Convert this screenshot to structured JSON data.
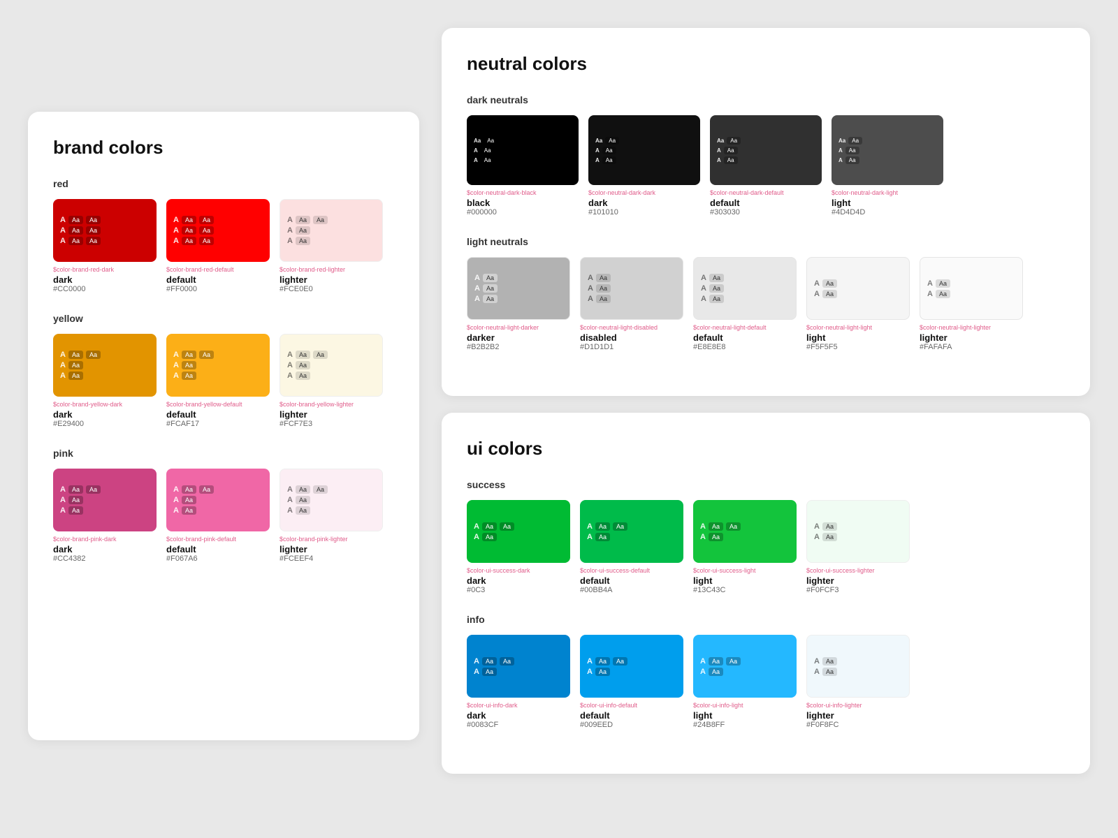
{
  "brand": {
    "title": "brand colors",
    "sections": [
      {
        "name": "red",
        "cards": [
          {
            "token": "$color-brand-red-dark",
            "name": "dark",
            "hex": "#CC0000",
            "bg": "#CC0000",
            "textStyle": "light"
          },
          {
            "token": "$color-brand-red-default",
            "name": "default",
            "hex": "#FF0000",
            "bg": "#FF0000",
            "textStyle": "light"
          },
          {
            "token": "$color-brand-red-lighter",
            "name": "lighter",
            "hex": "#FCE0E0",
            "bg": "#FCE0E0",
            "textStyle": "dark"
          }
        ]
      },
      {
        "name": "yellow",
        "cards": [
          {
            "token": "$color-brand-yellow-dark",
            "name": "dark",
            "hex": "#E29400",
            "bg": "#E29400",
            "textStyle": "light"
          },
          {
            "token": "$color-brand-yellow-default",
            "name": "default",
            "hex": "#FCAF17",
            "bg": "#FCAF17",
            "textStyle": "light"
          },
          {
            "token": "$color-brand-yellow-lighter",
            "name": "lighter",
            "hex": "#FCF7E3",
            "bg": "#FCF7E3",
            "textStyle": "dark"
          }
        ]
      },
      {
        "name": "pink",
        "cards": [
          {
            "token": "$color-brand-pink-dark",
            "name": "dark",
            "hex": "#CC4382",
            "bg": "#CC4382",
            "textStyle": "light"
          },
          {
            "token": "$color-brand-pink-default",
            "name": "default",
            "hex": "#F067A6",
            "bg": "#F067A6",
            "textStyle": "light"
          },
          {
            "token": "$color-brand-pink-lighter",
            "name": "lighter",
            "hex": "#FCEEF4",
            "bg": "#FCEEF4",
            "textStyle": "dark"
          }
        ]
      }
    ]
  },
  "neutral": {
    "title": "neutral colors",
    "darkSection": {
      "name": "dark neutrals",
      "cards": [
        {
          "token": "$color-neutral-dark-black",
          "name": "black",
          "hex": "#000000",
          "bg": "#000000",
          "textStyle": "light"
        },
        {
          "token": "$color-neutral-dark-dark",
          "name": "dark",
          "hex": "#101010",
          "bg": "#101010",
          "textStyle": "light"
        },
        {
          "token": "$color-neutral-dark-default",
          "name": "default",
          "hex": "#303030",
          "bg": "#303030",
          "textStyle": "light"
        },
        {
          "token": "$color-neutral-dark-light",
          "name": "light",
          "hex": "#4D4D4D",
          "bg": "#4D4D4D",
          "textStyle": "light"
        }
      ]
    },
    "lightSection": {
      "name": "light neutrals",
      "cards": [
        {
          "token": "$color-neutral-light-darker",
          "name": "darker",
          "hex": "#B2B2B2",
          "bg": "#B2B2B2",
          "textStyle": "light"
        },
        {
          "token": "$color-neutral-light-disabled",
          "name": "disabled",
          "hex": "#D1D1D1",
          "bg": "#D1D1D1",
          "textStyle": "light"
        },
        {
          "token": "$color-neutral-light-default",
          "name": "default",
          "hex": "#E8E8E8",
          "bg": "#E8E8E8",
          "textStyle": "dark"
        },
        {
          "token": "$color-neutral-light-light",
          "name": "light",
          "hex": "#F5F5F5",
          "bg": "#F5F5F5",
          "textStyle": "dark"
        },
        {
          "token": "$color-neutral-light-lighter",
          "name": "lighter",
          "hex": "#FAFAFA",
          "bg": "#FAFAFA",
          "textStyle": "dark"
        }
      ]
    }
  },
  "ui": {
    "title": "ui colors",
    "sections": [
      {
        "name": "success",
        "cards": [
          {
            "token": "$color-ui-success-dark",
            "name": "dark",
            "hex": "#0C3",
            "bg": "#00BB33",
            "textStyle": "light"
          },
          {
            "token": "$color-ui-success-default",
            "name": "default",
            "hex": "#00BB4A",
            "bg": "#00BB4A",
            "textStyle": "light"
          },
          {
            "token": "$color-ui-success-light",
            "name": "light",
            "hex": "#13C43C",
            "bg": "#13C43C",
            "textStyle": "light"
          },
          {
            "token": "$color-ui-success-lighter",
            "name": "lighter",
            "hex": "#F0FCF3",
            "bg": "#F0FCF3",
            "textStyle": "dark"
          }
        ]
      },
      {
        "name": "info",
        "cards": [
          {
            "token": "$color-ui-info-dark",
            "name": "dark",
            "hex": "#0083CF",
            "bg": "#0083CF",
            "textStyle": "light"
          },
          {
            "token": "$color-ui-info-default",
            "name": "default",
            "hex": "#009EED",
            "bg": "#009EED",
            "textStyle": "light"
          },
          {
            "token": "$color-ui-info-light",
            "name": "light",
            "hex": "#24B8FF",
            "bg": "#24B8FF",
            "textStyle": "light"
          },
          {
            "token": "$color-ui-info-lighter",
            "name": "lighter",
            "hex": "#F0F8FC",
            "bg": "#F0F8FC",
            "textStyle": "dark"
          }
        ]
      }
    ]
  }
}
